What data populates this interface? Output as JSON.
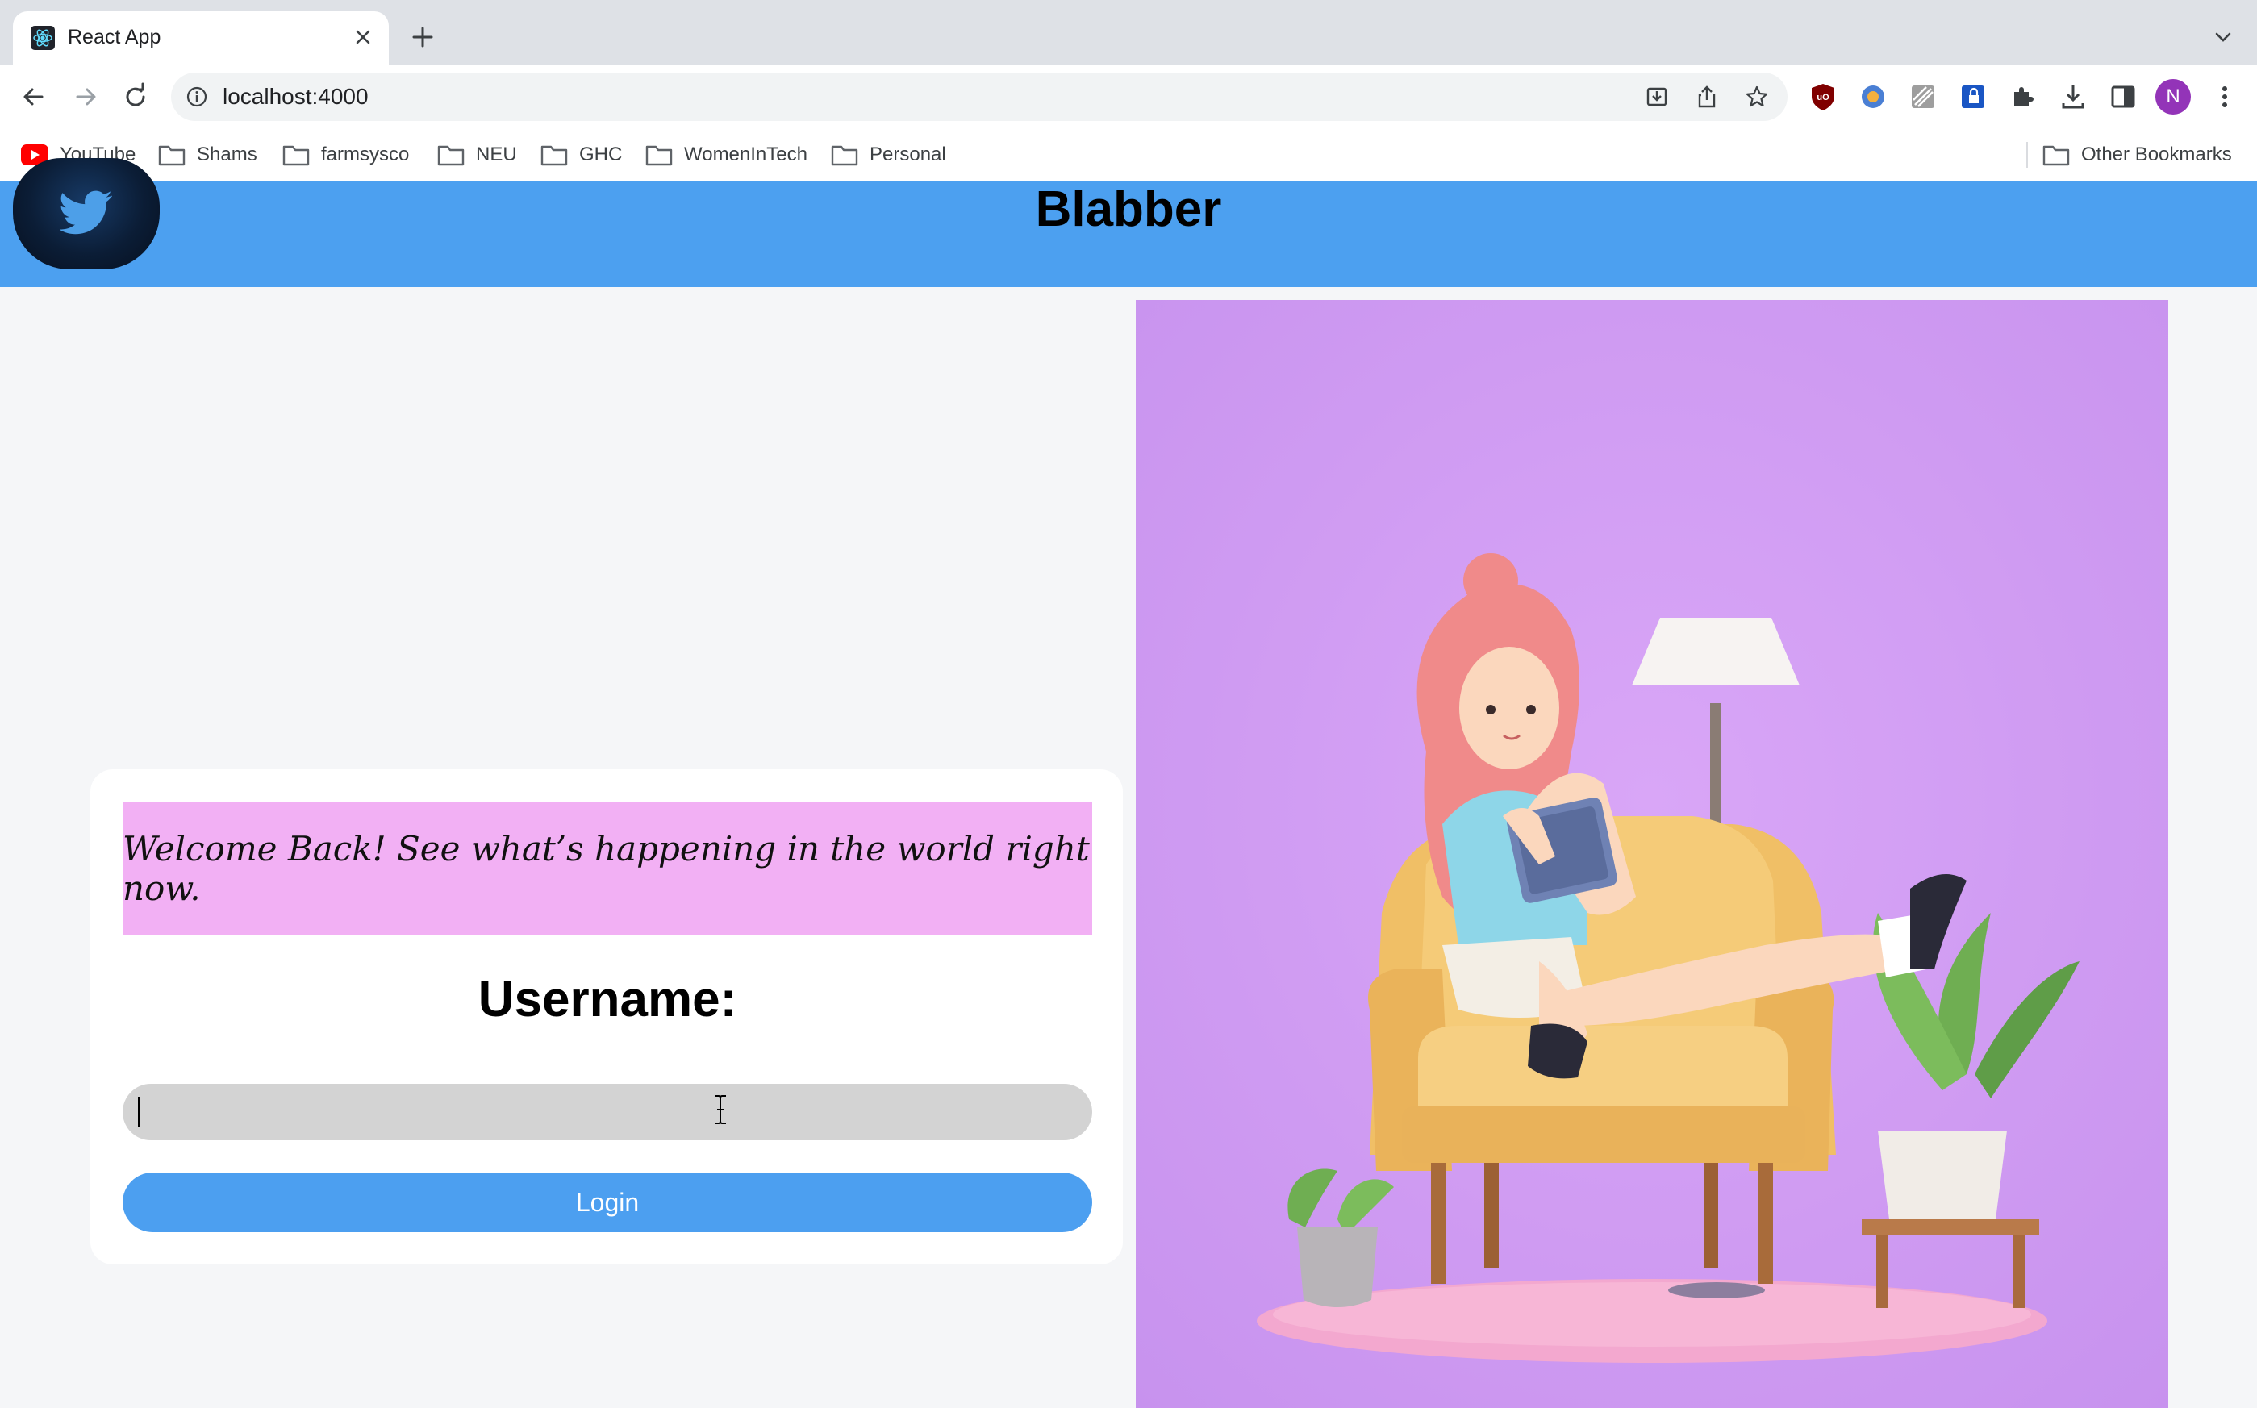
{
  "browser": {
    "tab_title": "React App",
    "url": "localhost:4000",
    "profile_initial": "N",
    "bookmarks": [
      {
        "label": "YouTube",
        "icon": "youtube-icon"
      },
      {
        "label": "Shams",
        "icon": "folder-icon"
      },
      {
        "label": "farmsysco",
        "icon": "folder-icon"
      },
      {
        "label": "NEU",
        "icon": "folder-icon"
      },
      {
        "label": "GHC",
        "icon": "folder-icon"
      },
      {
        "label": "WomenInTech",
        "icon": "folder-icon"
      },
      {
        "label": "Personal",
        "icon": "folder-icon"
      }
    ],
    "other_bookmarks": "Other Bookmarks"
  },
  "app": {
    "title": "Blabber",
    "welcome": "Welcome Back! See what’s happening in the world right now.",
    "username_label": "Username:",
    "username_value": "",
    "login_label": "Login"
  },
  "colors": {
    "header": "#4ca0f0",
    "banner": "#f2b0f4",
    "button": "#4c9ff0",
    "hero_bg": "#cf9bf3"
  }
}
